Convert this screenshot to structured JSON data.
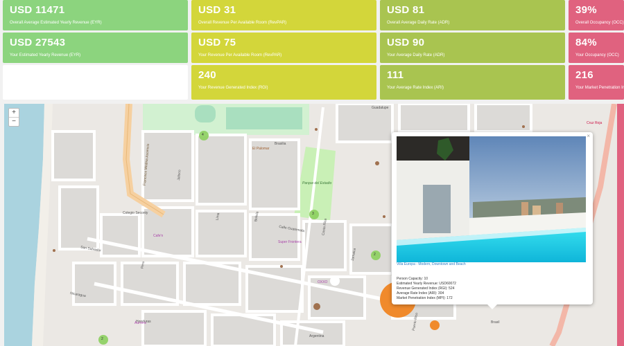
{
  "stats": {
    "row1": [
      {
        "value": "USD 11471",
        "label": "Overall Average Estimated Yearly Revenue (EYR)"
      },
      {
        "value": "USD 31",
        "label": "Overall Revenue Per Available Room (RevPAR)"
      },
      {
        "value": "USD 81",
        "label": "Overall Average Daily Rate (ADR)"
      },
      {
        "value": "39%",
        "label": "Overall Occupancy (OCC)"
      }
    ],
    "row2": [
      {
        "value": "USD 27543",
        "label": "Your Estimated Yearly Revenue (EYR)"
      },
      {
        "value": "USD 75",
        "label": "Your Revenue Per Available Room (RevPAR)"
      },
      {
        "value": "USD 90",
        "label": "Your Average Daily Rate (ADR)"
      },
      {
        "value": "84%",
        "label": "Your Occupancy (OCC)"
      }
    ],
    "row3": [
      {
        "value": "240",
        "label": "Your Revenue Generated Index (RGI)"
      },
      {
        "value": "111",
        "label": "Your Average Rate Index (ARI)"
      },
      {
        "value": "216",
        "label": "Your Market Penetration Index (MPI)"
      }
    ]
  },
  "colors": {
    "green": "#8cd47e",
    "yellow": "#d3d63a",
    "olive": "#a9c450",
    "pink": "#e0627f"
  },
  "map": {
    "zoom_in": "+",
    "zoom_out": "−",
    "streets": [
      "Brasilia",
      "Calle Guatemala",
      "San Salvador",
      "Nicaragua",
      "Brasil",
      "Jalisco",
      "Jamaica",
      "Lima",
      "Bolivia",
      "Peru",
      "Honduras",
      "Argentina",
      "Puerto Rico",
      "Guadalupe",
      "Francisco Medina Ascencio",
      "Costa Rica"
    ],
    "places": [
      "Parque del Estadio",
      "Colegio Seconty",
      "Cruz Roja",
      "Super Frontera",
      "OXXO",
      "Aurrera",
      "El Palomar",
      "Cafe'n"
    ],
    "cluster_counts": [
      "4",
      "3",
      "2",
      "2"
    ],
    "popup": {
      "close": "×",
      "caption": "Villa Europa - Modern, Downtown and Beach",
      "details": [
        "Person Capacity: 10",
        "Estimated Yearly Revenue: USD60072",
        "Revenue Generated Index (RGI): 524",
        "Average Rate Index (ARI): 304",
        "Market Penetration Index (MPI): 172"
      ]
    }
  }
}
